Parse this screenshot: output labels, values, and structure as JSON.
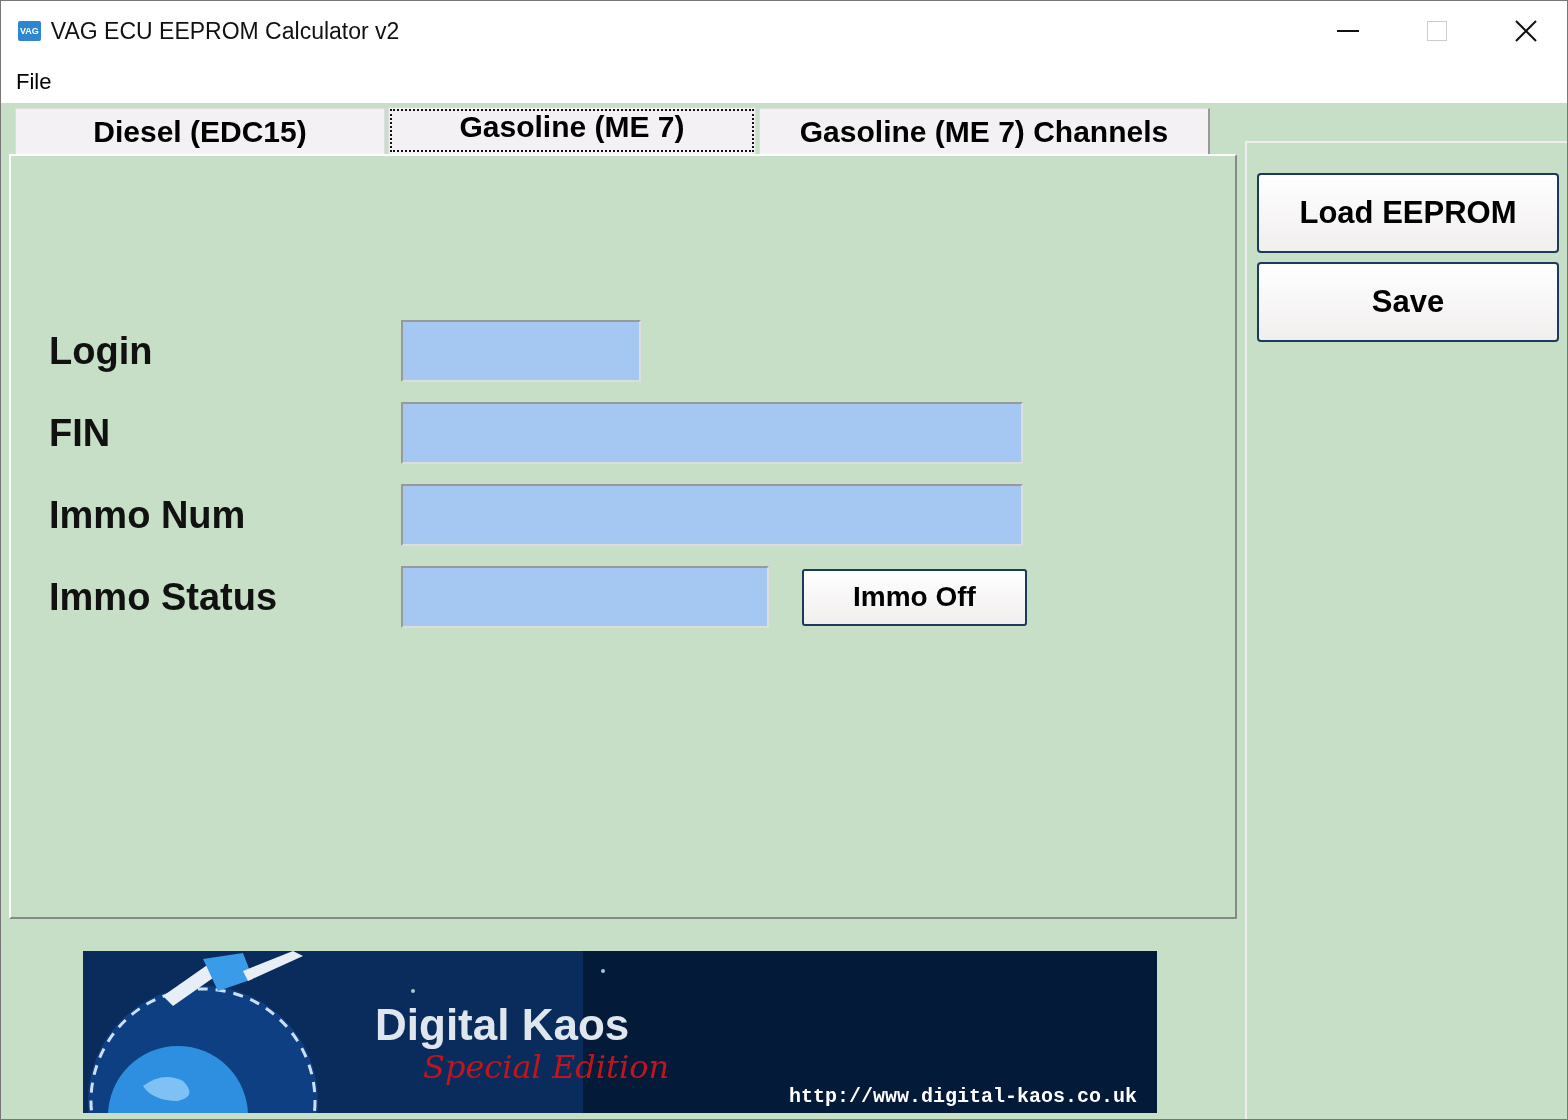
{
  "window": {
    "title": "VAG ECU EEPROM Calculator v2",
    "icon_text": "VAG"
  },
  "menu": [
    "File"
  ],
  "tabs": [
    {
      "label": "Diesel (EDC15)",
      "selected": false
    },
    {
      "label": "Gasoline (ME 7)",
      "selected": true
    },
    {
      "label": "Gasoline (ME 7) Channels",
      "selected": false
    }
  ],
  "fields": [
    {
      "label": "Login"
    },
    {
      "label": "FIN"
    },
    {
      "label": "Immo Num"
    },
    {
      "label": "Immo Status",
      "button": "Immo Off"
    }
  ],
  "side_buttons": [
    "Load EEPROM",
    "Save"
  ],
  "banner": {
    "title": "Digital Kaos",
    "subtitle": "Special Edition",
    "url": "http://www.digital-kaos.co.uk"
  }
}
